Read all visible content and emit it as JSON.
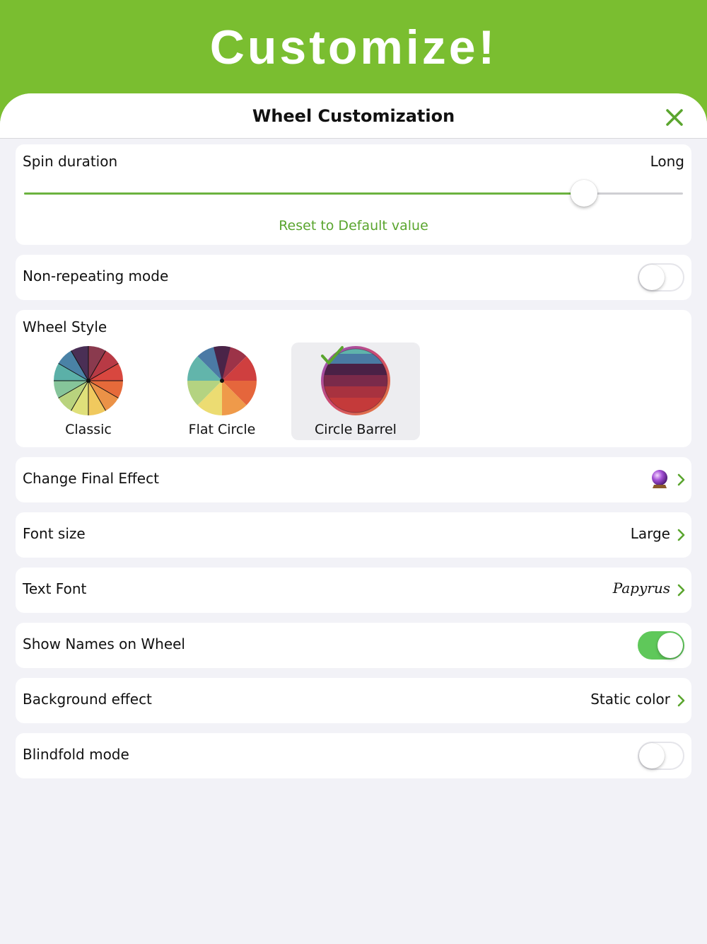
{
  "banner": {
    "title": "Customize!"
  },
  "sheet": {
    "title": "Wheel Customization",
    "close_icon": "close-x-icon"
  },
  "spin_duration": {
    "label": "Spin duration",
    "value": "Long",
    "slider_level_percent": 85,
    "reset_label": "Reset to Default value"
  },
  "non_repeating": {
    "label": "Non-repeating mode",
    "enabled": false
  },
  "wheel_style": {
    "label": "Wheel Style",
    "options": [
      {
        "label": "Classic",
        "selected": false
      },
      {
        "label": "Flat Circle",
        "selected": false
      },
      {
        "label": "Circle Barrel",
        "selected": true
      }
    ]
  },
  "final_effect": {
    "label": "Change Final Effect",
    "icon": "crystal-ball-icon"
  },
  "font_size": {
    "label": "Font size",
    "value": "Large"
  },
  "text_font": {
    "label": "Text Font",
    "value": "Papyrus"
  },
  "show_names": {
    "label": "Show Names on Wheel",
    "enabled": true
  },
  "background_effect": {
    "label": "Background effect",
    "value": "Static color"
  },
  "blindfold": {
    "label": "Blindfold mode",
    "enabled": false
  },
  "colors": {
    "banner_green": "#7abe30",
    "accent_green": "#5aa52e",
    "toggle_on": "#5fc85a",
    "sheet_bg": "#f2f2f7"
  }
}
